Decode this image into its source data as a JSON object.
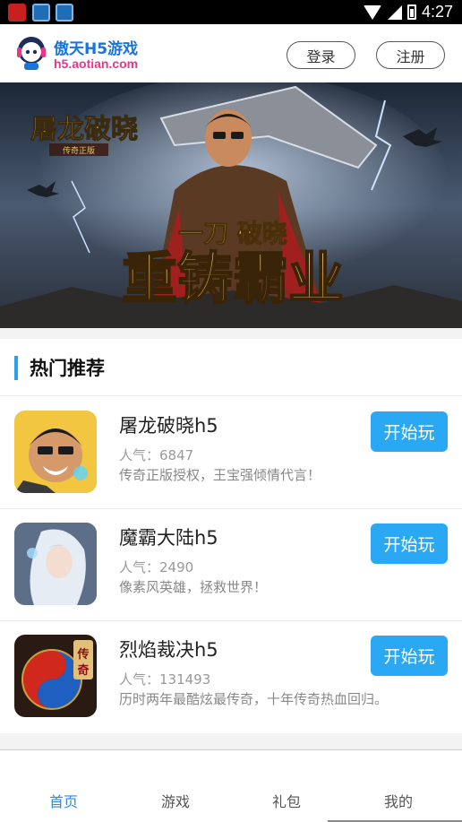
{
  "status_bar": {
    "time": "4:27",
    "icons": [
      "app-notification-icon",
      "app-notification-icon",
      "app-notification-icon",
      "wifi-icon",
      "signal-icon",
      "battery-icon"
    ]
  },
  "header": {
    "site_name": "傲天H5游戏",
    "site_url": "h5.aotian.com",
    "login_label": "登录",
    "register_label": "注册"
  },
  "banner": {
    "game_logo_text": "屠龙破晓",
    "game_logo_subtext": "传奇正版",
    "slogan_top": "一刀 破晓",
    "slogan_main": "重铸霸业",
    "slides_count": 3,
    "active_slide": 1
  },
  "hot": {
    "title": "热门推荐",
    "games": [
      {
        "name": "屠龙破晓h5",
        "popularity": "人气：6847",
        "description": "传奇正版授权，王宝强倾情代言！",
        "play_label": "开始玩"
      },
      {
        "name": "魔霸大陆h5",
        "popularity": "人气：2490",
        "description": "像素风英雄，拯救世界！",
        "play_label": "开始玩"
      },
      {
        "name": "烈焰裁决h5",
        "popularity": "人气：131493",
        "description": "历时两年最酷炫最传奇，十年传奇热血回归。",
        "play_label": "开始玩"
      }
    ]
  },
  "bottom_nav": {
    "items": [
      {
        "label": "首页",
        "active": true
      },
      {
        "label": "游戏",
        "active": false
      },
      {
        "label": "礼包",
        "active": false
      },
      {
        "label": "我的",
        "active": false
      }
    ]
  },
  "colors": {
    "accent_blue": "#2aa8f4",
    "active_nav": "#2a8ae6",
    "brand_pink": "#e9358a",
    "brand_blue": "#1d74d8",
    "slide_dot_active": "#f0841b"
  }
}
